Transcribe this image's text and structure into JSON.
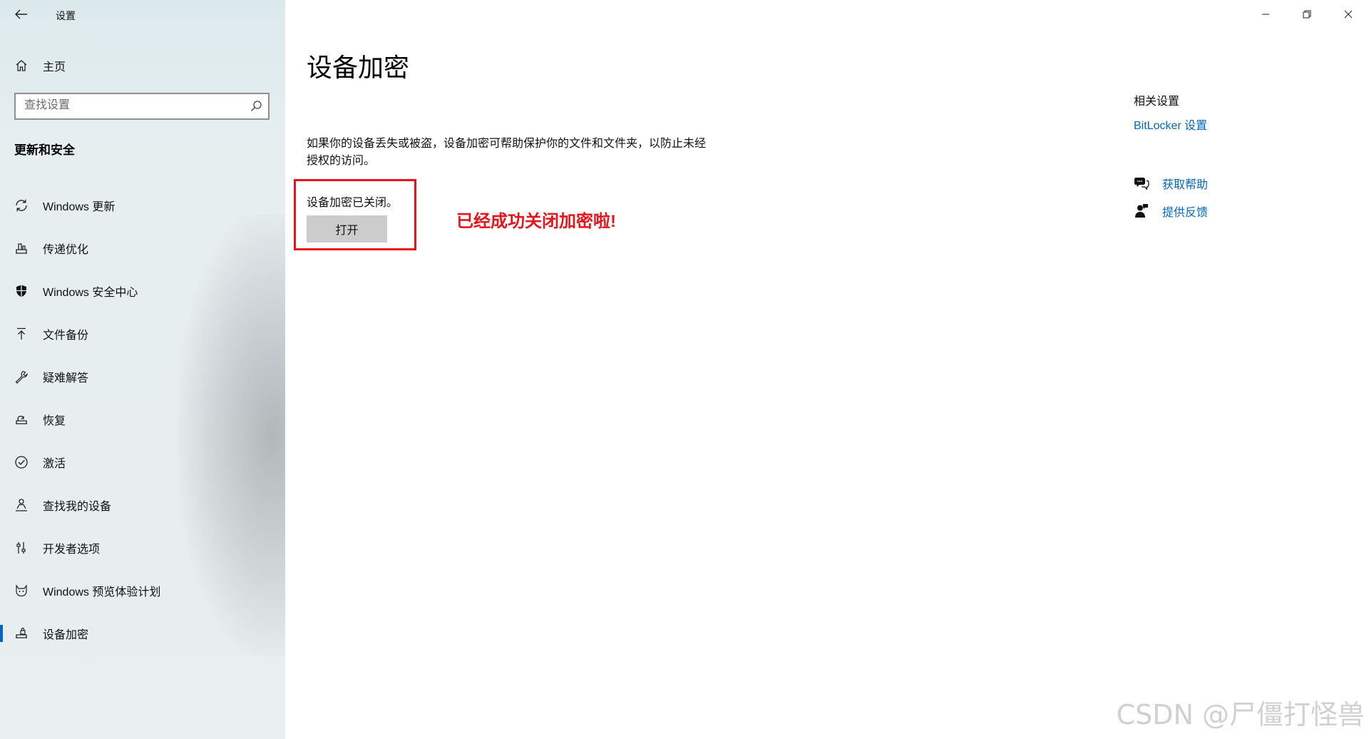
{
  "window": {
    "title": "设置"
  },
  "sidebar": {
    "home_label": "主页",
    "search_placeholder": "查找设置",
    "section_title": "更新和安全",
    "items": [
      {
        "label": "Windows 更新",
        "icon": "sync-icon"
      },
      {
        "label": "传递优化",
        "icon": "delivery-optimization-icon"
      },
      {
        "label": "Windows 安全中心",
        "icon": "shield-icon"
      },
      {
        "label": "文件备份",
        "icon": "backup-arrow-up-icon"
      },
      {
        "label": "疑难解答",
        "icon": "wrench-icon"
      },
      {
        "label": "恢复",
        "icon": "recovery-icon"
      },
      {
        "label": "激活",
        "icon": "check-circle-icon"
      },
      {
        "label": "查找我的设备",
        "icon": "find-device-person-icon"
      },
      {
        "label": "开发者选项",
        "icon": "developer-sliders-icon"
      },
      {
        "label": "Windows 预览体验计划",
        "icon": "insider-cat-icon"
      },
      {
        "label": "设备加密",
        "icon": "device-encryption-icon",
        "selected": true
      }
    ]
  },
  "main": {
    "page_title": "设备加密",
    "description": "如果你的设备丢失或被盗，设备加密可帮助保护你的文件和文件夹，以防止未经授权的访问。",
    "status_text": "设备加密已关闭。",
    "open_button_label": "打开",
    "annotation": "已经成功关闭加密啦!"
  },
  "related": {
    "title": "相关设置",
    "bitlocker_link": "BitLocker 设置",
    "get_help": "获取帮助",
    "feedback": "提供反馈"
  },
  "watermark": "CSDN @尸僵打怪兽",
  "colors": {
    "accent": "#0067c0",
    "annotation_red": "#e6141b",
    "button_gray": "#cccccc"
  }
}
